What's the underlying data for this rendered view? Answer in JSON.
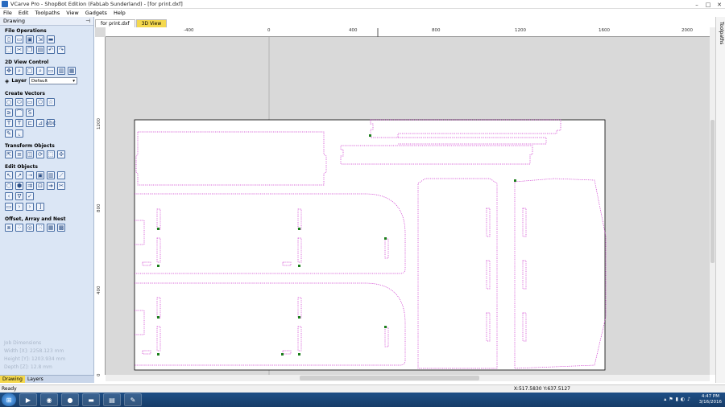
{
  "window": {
    "title": "VCarve Pro - ShopBot Edition (FabLab Sunderland) - [for print.dxf]"
  },
  "menu": [
    "File",
    "Edit",
    "Toolpaths",
    "View",
    "Gadgets",
    "Help"
  ],
  "panel": {
    "header": "Drawing",
    "pin_icon": "pin-icon",
    "sections": {
      "file_ops": "File Operations",
      "view_control": "2D View Control",
      "create_vectors": "Create Vectors",
      "transform": "Transform Objects",
      "edit": "Edit Objects",
      "offset": "Offset, Array and Nest"
    },
    "layer_label": "Layer",
    "layer_value": "Default",
    "job": {
      "title": "Job Dimensions",
      "width": "Width  [X]: 2258.123 mm",
      "height": "Height [Y]: 1203.934 mm",
      "depth": "Depth  [Z]: 12.8 mm"
    },
    "tabs": [
      "Drawing",
      "Layers"
    ]
  },
  "doc_tabs": [
    "for print.dxf",
    "3D View"
  ],
  "ruler": {
    "h_labels": [
      "-400",
      "0",
      "400",
      "800",
      "1200",
      "1600",
      "2000"
    ],
    "v_labels": [
      "1200",
      "800",
      "400",
      "0"
    ]
  },
  "right_tab": "Toolpaths",
  "status": {
    "left": "Ready",
    "coords": "X:517.5830 Y:637.5127"
  },
  "clock": {
    "time": "4:47 PM",
    "date": "3/16/2016"
  },
  "colors": {
    "vector": "#cc33cc",
    "accent_tab": "#f4d84e",
    "panel": "#dbe6f5"
  }
}
